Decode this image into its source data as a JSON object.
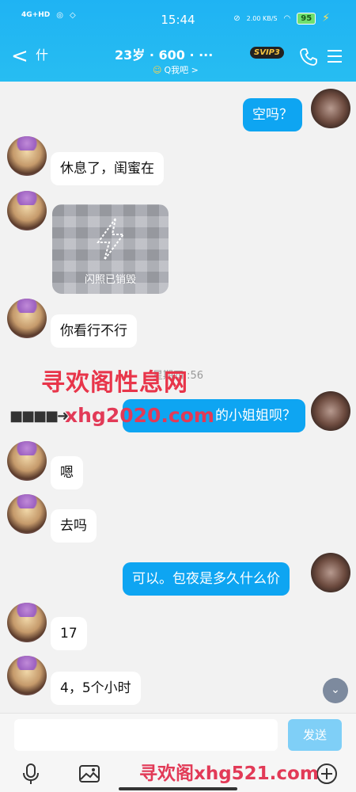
{
  "status_bar": {
    "network": "4G+HD",
    "time": "15:44",
    "net_speed": "2.00 KB/S",
    "battery": "95"
  },
  "header": {
    "back_glyph": "<",
    "contact_name": "什",
    "contact_meta": "23岁 · 600 · ···",
    "sub_label": "Q我吧 >",
    "vip_badge": "SVIP3"
  },
  "messages": [
    {
      "side": "right",
      "text": "空吗？"
    },
    {
      "side": "left",
      "text": "休息了，闺蜜在"
    },
    {
      "side": "left",
      "type": "flash-photo",
      "text": "闪照已销毁"
    },
    {
      "side": "left",
      "text": "你看行不行"
    },
    {
      "side": "right",
      "text": "的小姐姐呗？"
    },
    {
      "side": "left",
      "text": "嗯"
    },
    {
      "side": "left",
      "text": "去吗"
    },
    {
      "side": "right",
      "text": "可以。包夜是多久什么价"
    },
    {
      "side": "left",
      "text": "17"
    },
    {
      "side": "left",
      "text": "4，5个小时"
    }
  ],
  "timestamp_text": "星期四 :56",
  "watermarks": {
    "top": "寻欢阁性息网",
    "middle": "xhg2020.com",
    "bottom": "寻欢阁xhg521.com"
  },
  "input": {
    "value": "",
    "send_label": "发送"
  },
  "icons": [
    "back-icon",
    "phone-icon",
    "menu-icon",
    "flash-icon",
    "chevron-down-icon",
    "mic-icon",
    "image-icon",
    "plus-icon"
  ],
  "colors": {
    "header": "#1fb3f3",
    "bubble_right": "#0ea5f2",
    "bubble_left": "#ffffff",
    "send_button": "#7fcff7",
    "watermark": "#e23a57"
  }
}
